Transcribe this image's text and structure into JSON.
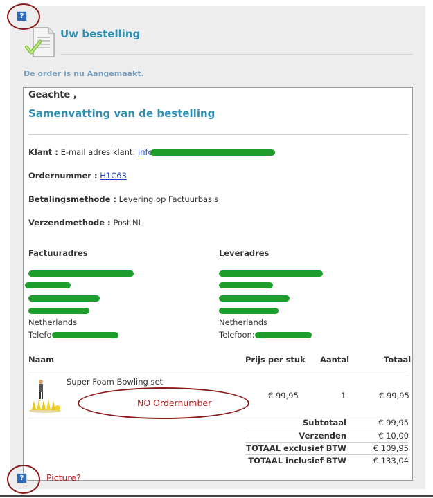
{
  "header": {
    "title": "Uw bestelling",
    "status": "De order is nu Aangemaakt."
  },
  "summary": {
    "greeting": "Geachte ,",
    "title": "Samenvatting van de bestelling"
  },
  "order": {
    "customer_label": "Klant :",
    "customer_email_label": "E-mail adres klant:",
    "customer_email_visible": "info",
    "order_number_label": "Ordernummer :",
    "order_number": "H1C63",
    "payment_label": "Betalingsmethode :",
    "payment_value": "Levering op Factuurbasis",
    "shipping_label": "Verzendmethode :",
    "shipping_value": "Post NL"
  },
  "billing": {
    "heading": "Factuuradres",
    "country": "Netherlands",
    "phone_label": "Telefo"
  },
  "delivery": {
    "heading": "Leveradres",
    "country": "Netherlands",
    "phone_label": "Telefoon:"
  },
  "table": {
    "headers": {
      "name": "Naam",
      "price": "Prijs per stuk",
      "qty": "Aantal",
      "total": "Totaal"
    },
    "items": [
      {
        "name": "Super Foam Bowling set",
        "price": "€ 99,95",
        "qty": "1",
        "total": "€ 99,95"
      }
    ]
  },
  "totals": [
    {
      "label": "Subtotaal",
      "value": "€ 99,95"
    },
    {
      "label": "Verzenden",
      "value": "€ 10,00"
    },
    {
      "label": "TOTAAL exclusief BTW",
      "value": "€ 109,95"
    },
    {
      "label": "TOTAAL inclusief BTW",
      "value": "€ 133,04"
    }
  ],
  "annotations": {
    "no_ordernumber": "NO Ordernumber",
    "picture": "Picture?",
    "question_icon_glyph": "?"
  },
  "colors": {
    "accent_blue": "#2f8fb0",
    "status_blue": "#7a9fbd",
    "redaction_green": "#1f9d2c",
    "annotation_red": "#8b1a1a"
  },
  "icons": [
    "help-icon",
    "document-check-icon",
    "product-thumbnail"
  ]
}
